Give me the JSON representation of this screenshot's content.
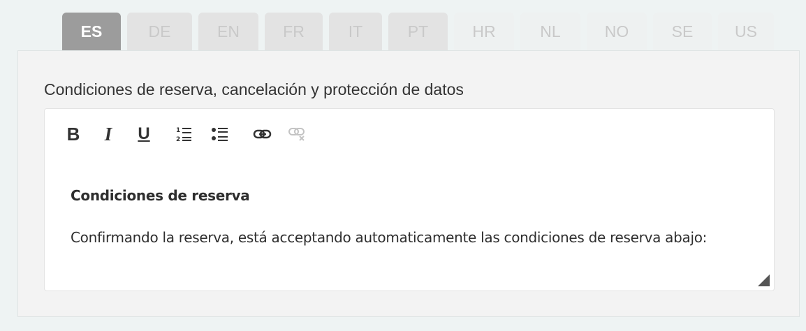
{
  "tabs": [
    {
      "label": "ES",
      "state": "active"
    },
    {
      "label": "DE",
      "state": "normal"
    },
    {
      "label": "EN",
      "state": "normal"
    },
    {
      "label": "FR",
      "state": "normal"
    },
    {
      "label": "IT",
      "state": "normal"
    },
    {
      "label": "PT",
      "state": "normal"
    },
    {
      "label": "HR",
      "state": "faint"
    },
    {
      "label": "NL",
      "state": "faint"
    },
    {
      "label": "NO",
      "state": "faint"
    },
    {
      "label": "SE",
      "state": "faint"
    },
    {
      "label": "US",
      "state": "faint"
    }
  ],
  "field": {
    "label": "Condiciones de reserva, cancelación y protección de datos"
  },
  "toolbar": {
    "buttons": [
      "bold-icon",
      "italic-icon",
      "underline-icon",
      "ordered-list-icon",
      "bullet-list-icon",
      "link-icon",
      "unlink-icon"
    ],
    "bold": "B",
    "italic": "I",
    "underline": "U"
  },
  "editor": {
    "heading": "Condiciones de reserva",
    "paragraph": "Confirmando la reserva, está acceptando automaticamente las condiciones de reserva abajo:"
  },
  "colors": {
    "active_tab": "#9c9c9c",
    "inactive_tab": "#e3e3e3",
    "panel": "#f3f3f3",
    "page": "#eef3f3"
  }
}
